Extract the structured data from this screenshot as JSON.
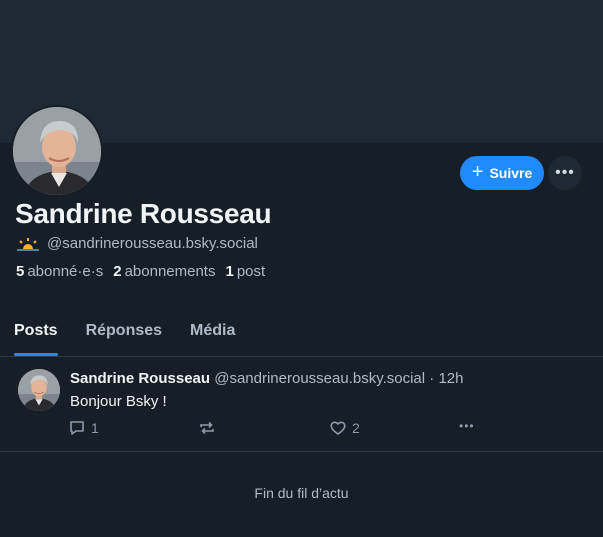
{
  "profile": {
    "display_name": "Sandrine Rousseau",
    "handle": "@sandrinerousseau.bsky.social",
    "handle_icon": "sunrise-emoji",
    "followers_count": "5",
    "followers_label": "abonné·e·s",
    "following_count": "2",
    "following_label": "abonnements",
    "posts_count": "1",
    "posts_label": "post"
  },
  "actions": {
    "follow_label": "Suivre",
    "more_icon": "more-horizontal-icon"
  },
  "tabs": [
    {
      "label": "Posts",
      "active": true
    },
    {
      "label": "Réponses",
      "active": false
    },
    {
      "label": "Média",
      "active": false
    }
  ],
  "post": {
    "author": "Sandrine Rousseau",
    "handle": "@sandrinerousseau.bsky.social",
    "separator": "·",
    "time": "12h",
    "text": "Bonjour Bsky !",
    "reply_count": "1",
    "like_count": "2"
  },
  "feed_end": "Fin du fil d’actu",
  "colors": {
    "background": "#161e27",
    "banner": "#1e2936",
    "accent": "#208bfe",
    "text": "#f1f3f5",
    "muted": "#aebbc9"
  }
}
